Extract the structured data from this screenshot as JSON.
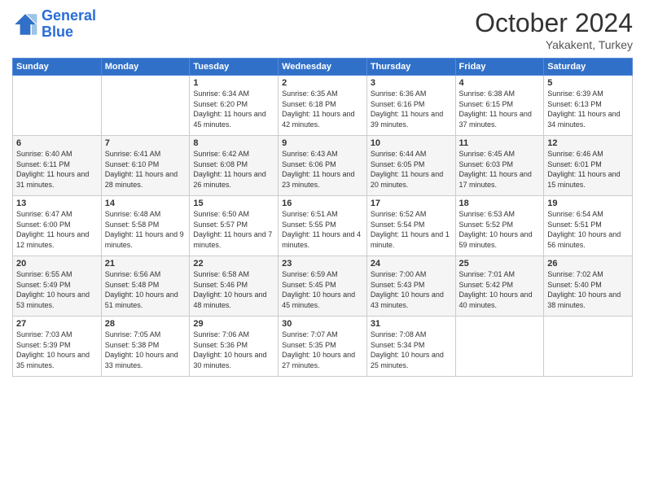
{
  "logo": {
    "line1": "General",
    "line2": "Blue"
  },
  "header": {
    "month": "October 2024",
    "location": "Yakakent, Turkey"
  },
  "weekdays": [
    "Sunday",
    "Monday",
    "Tuesday",
    "Wednesday",
    "Thursday",
    "Friday",
    "Saturday"
  ],
  "weeks": [
    [
      {
        "day": "",
        "sunrise": "",
        "sunset": "",
        "daylight": ""
      },
      {
        "day": "",
        "sunrise": "",
        "sunset": "",
        "daylight": ""
      },
      {
        "day": "1",
        "sunrise": "Sunrise: 6:34 AM",
        "sunset": "Sunset: 6:20 PM",
        "daylight": "Daylight: 11 hours and 45 minutes."
      },
      {
        "day": "2",
        "sunrise": "Sunrise: 6:35 AM",
        "sunset": "Sunset: 6:18 PM",
        "daylight": "Daylight: 11 hours and 42 minutes."
      },
      {
        "day": "3",
        "sunrise": "Sunrise: 6:36 AM",
        "sunset": "Sunset: 6:16 PM",
        "daylight": "Daylight: 11 hours and 39 minutes."
      },
      {
        "day": "4",
        "sunrise": "Sunrise: 6:38 AM",
        "sunset": "Sunset: 6:15 PM",
        "daylight": "Daylight: 11 hours and 37 minutes."
      },
      {
        "day": "5",
        "sunrise": "Sunrise: 6:39 AM",
        "sunset": "Sunset: 6:13 PM",
        "daylight": "Daylight: 11 hours and 34 minutes."
      }
    ],
    [
      {
        "day": "6",
        "sunrise": "Sunrise: 6:40 AM",
        "sunset": "Sunset: 6:11 PM",
        "daylight": "Daylight: 11 hours and 31 minutes."
      },
      {
        "day": "7",
        "sunrise": "Sunrise: 6:41 AM",
        "sunset": "Sunset: 6:10 PM",
        "daylight": "Daylight: 11 hours and 28 minutes."
      },
      {
        "day": "8",
        "sunrise": "Sunrise: 6:42 AM",
        "sunset": "Sunset: 6:08 PM",
        "daylight": "Daylight: 11 hours and 26 minutes."
      },
      {
        "day": "9",
        "sunrise": "Sunrise: 6:43 AM",
        "sunset": "Sunset: 6:06 PM",
        "daylight": "Daylight: 11 hours and 23 minutes."
      },
      {
        "day": "10",
        "sunrise": "Sunrise: 6:44 AM",
        "sunset": "Sunset: 6:05 PM",
        "daylight": "Daylight: 11 hours and 20 minutes."
      },
      {
        "day": "11",
        "sunrise": "Sunrise: 6:45 AM",
        "sunset": "Sunset: 6:03 PM",
        "daylight": "Daylight: 11 hours and 17 minutes."
      },
      {
        "day": "12",
        "sunrise": "Sunrise: 6:46 AM",
        "sunset": "Sunset: 6:01 PM",
        "daylight": "Daylight: 11 hours and 15 minutes."
      }
    ],
    [
      {
        "day": "13",
        "sunrise": "Sunrise: 6:47 AM",
        "sunset": "Sunset: 6:00 PM",
        "daylight": "Daylight: 11 hours and 12 minutes."
      },
      {
        "day": "14",
        "sunrise": "Sunrise: 6:48 AM",
        "sunset": "Sunset: 5:58 PM",
        "daylight": "Daylight: 11 hours and 9 minutes."
      },
      {
        "day": "15",
        "sunrise": "Sunrise: 6:50 AM",
        "sunset": "Sunset: 5:57 PM",
        "daylight": "Daylight: 11 hours and 7 minutes."
      },
      {
        "day": "16",
        "sunrise": "Sunrise: 6:51 AM",
        "sunset": "Sunset: 5:55 PM",
        "daylight": "Daylight: 11 hours and 4 minutes."
      },
      {
        "day": "17",
        "sunrise": "Sunrise: 6:52 AM",
        "sunset": "Sunset: 5:54 PM",
        "daylight": "Daylight: 11 hours and 1 minute."
      },
      {
        "day": "18",
        "sunrise": "Sunrise: 6:53 AM",
        "sunset": "Sunset: 5:52 PM",
        "daylight": "Daylight: 10 hours and 59 minutes."
      },
      {
        "day": "19",
        "sunrise": "Sunrise: 6:54 AM",
        "sunset": "Sunset: 5:51 PM",
        "daylight": "Daylight: 10 hours and 56 minutes."
      }
    ],
    [
      {
        "day": "20",
        "sunrise": "Sunrise: 6:55 AM",
        "sunset": "Sunset: 5:49 PM",
        "daylight": "Daylight: 10 hours and 53 minutes."
      },
      {
        "day": "21",
        "sunrise": "Sunrise: 6:56 AM",
        "sunset": "Sunset: 5:48 PM",
        "daylight": "Daylight: 10 hours and 51 minutes."
      },
      {
        "day": "22",
        "sunrise": "Sunrise: 6:58 AM",
        "sunset": "Sunset: 5:46 PM",
        "daylight": "Daylight: 10 hours and 48 minutes."
      },
      {
        "day": "23",
        "sunrise": "Sunrise: 6:59 AM",
        "sunset": "Sunset: 5:45 PM",
        "daylight": "Daylight: 10 hours and 45 minutes."
      },
      {
        "day": "24",
        "sunrise": "Sunrise: 7:00 AM",
        "sunset": "Sunset: 5:43 PM",
        "daylight": "Daylight: 10 hours and 43 minutes."
      },
      {
        "day": "25",
        "sunrise": "Sunrise: 7:01 AM",
        "sunset": "Sunset: 5:42 PM",
        "daylight": "Daylight: 10 hours and 40 minutes."
      },
      {
        "day": "26",
        "sunrise": "Sunrise: 7:02 AM",
        "sunset": "Sunset: 5:40 PM",
        "daylight": "Daylight: 10 hours and 38 minutes."
      }
    ],
    [
      {
        "day": "27",
        "sunrise": "Sunrise: 7:03 AM",
        "sunset": "Sunset: 5:39 PM",
        "daylight": "Daylight: 10 hours and 35 minutes."
      },
      {
        "day": "28",
        "sunrise": "Sunrise: 7:05 AM",
        "sunset": "Sunset: 5:38 PM",
        "daylight": "Daylight: 10 hours and 33 minutes."
      },
      {
        "day": "29",
        "sunrise": "Sunrise: 7:06 AM",
        "sunset": "Sunset: 5:36 PM",
        "daylight": "Daylight: 10 hours and 30 minutes."
      },
      {
        "day": "30",
        "sunrise": "Sunrise: 7:07 AM",
        "sunset": "Sunset: 5:35 PM",
        "daylight": "Daylight: 10 hours and 27 minutes."
      },
      {
        "day": "31",
        "sunrise": "Sunrise: 7:08 AM",
        "sunset": "Sunset: 5:34 PM",
        "daylight": "Daylight: 10 hours and 25 minutes."
      },
      {
        "day": "",
        "sunrise": "",
        "sunset": "",
        "daylight": ""
      },
      {
        "day": "",
        "sunrise": "",
        "sunset": "",
        "daylight": ""
      }
    ]
  ]
}
